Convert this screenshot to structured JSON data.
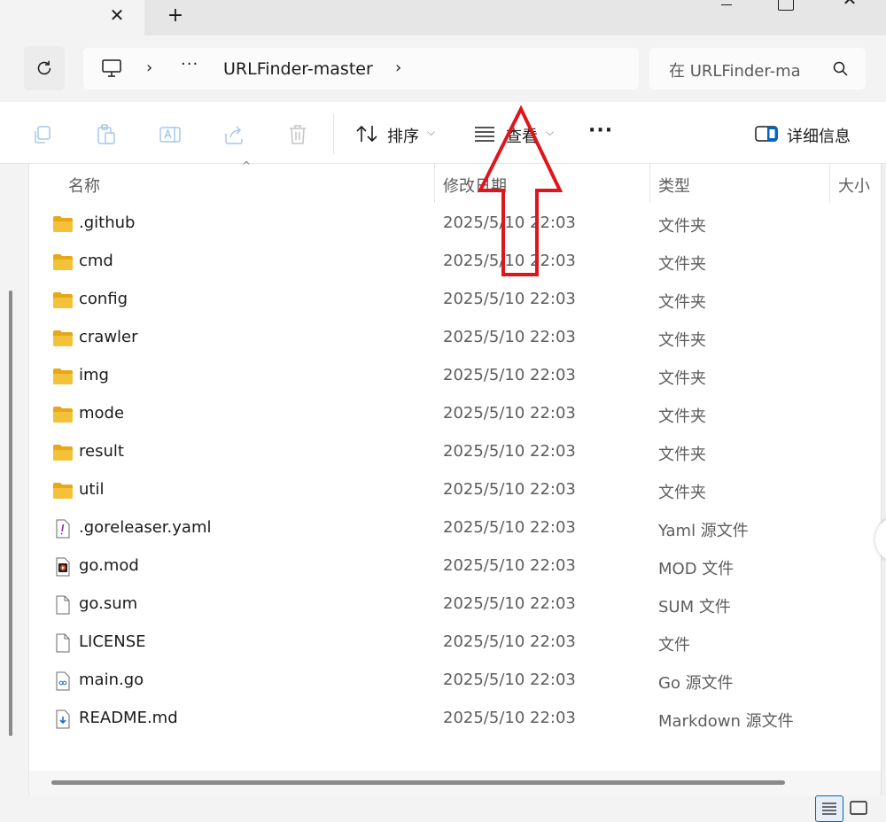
{
  "tabs": {
    "close_glyph": "✕",
    "new_tab_glyph": "+"
  },
  "window": {
    "close_glyph": "✕"
  },
  "breadcrumb": {
    "chevron": "›",
    "ellipsis": "···",
    "current": "URLFinder-master"
  },
  "search": {
    "value": "在 URLFinder-ma"
  },
  "toolbar": {
    "sort_label": "排序",
    "view_label": "查看",
    "more_label": "···",
    "details_label": "详细信息",
    "dropdown_chevron": "⌵"
  },
  "columns": {
    "name": "名称",
    "date": "修改日期",
    "type": "类型",
    "size": "大小",
    "sort_indicator": "^"
  },
  "files": [
    {
      "name": ".github",
      "date": "2025/5/10 22:03",
      "type": "文件夹",
      "icon": "folder-icon"
    },
    {
      "name": "cmd",
      "date": "2025/5/10 22:03",
      "type": "文件夹",
      "icon": "folder-icon"
    },
    {
      "name": "config",
      "date": "2025/5/10 22:03",
      "type": "文件夹",
      "icon": "folder-icon"
    },
    {
      "name": "crawler",
      "date": "2025/5/10 22:03",
      "type": "文件夹",
      "icon": "folder-icon"
    },
    {
      "name": "img",
      "date": "2025/5/10 22:03",
      "type": "文件夹",
      "icon": "folder-icon"
    },
    {
      "name": "mode",
      "date": "2025/5/10 22:03",
      "type": "文件夹",
      "icon": "folder-icon"
    },
    {
      "name": "result",
      "date": "2025/5/10 22:03",
      "type": "文件夹",
      "icon": "folder-icon"
    },
    {
      "name": "util",
      "date": "2025/5/10 22:03",
      "type": "文件夹",
      "icon": "folder-icon"
    },
    {
      "name": ".goreleaser.yaml",
      "date": "2025/5/10 22:03",
      "type": "Yaml 源文件",
      "icon": "yaml-file-icon"
    },
    {
      "name": "go.mod",
      "date": "2025/5/10 22:03",
      "type": "MOD 文件",
      "icon": "mod-file-icon"
    },
    {
      "name": "go.sum",
      "date": "2025/5/10 22:03",
      "type": "SUM 文件",
      "icon": "blank-file-icon"
    },
    {
      "name": "LICENSE",
      "date": "2025/5/10 22:03",
      "type": "文件",
      "icon": "blank-file-icon"
    },
    {
      "name": "main.go",
      "date": "2025/5/10 22:03",
      "type": "Go 源文件",
      "icon": "go-file-icon"
    },
    {
      "name": "README.md",
      "date": "2025/5/10 22:03",
      "type": "Markdown 源文件",
      "icon": "markdown-file-icon"
    }
  ],
  "colors": {
    "folder": "#f4c23a",
    "folder_dark": "#e6a817",
    "accent": "#0067c0",
    "annotation_arrow": "#e0151b"
  }
}
